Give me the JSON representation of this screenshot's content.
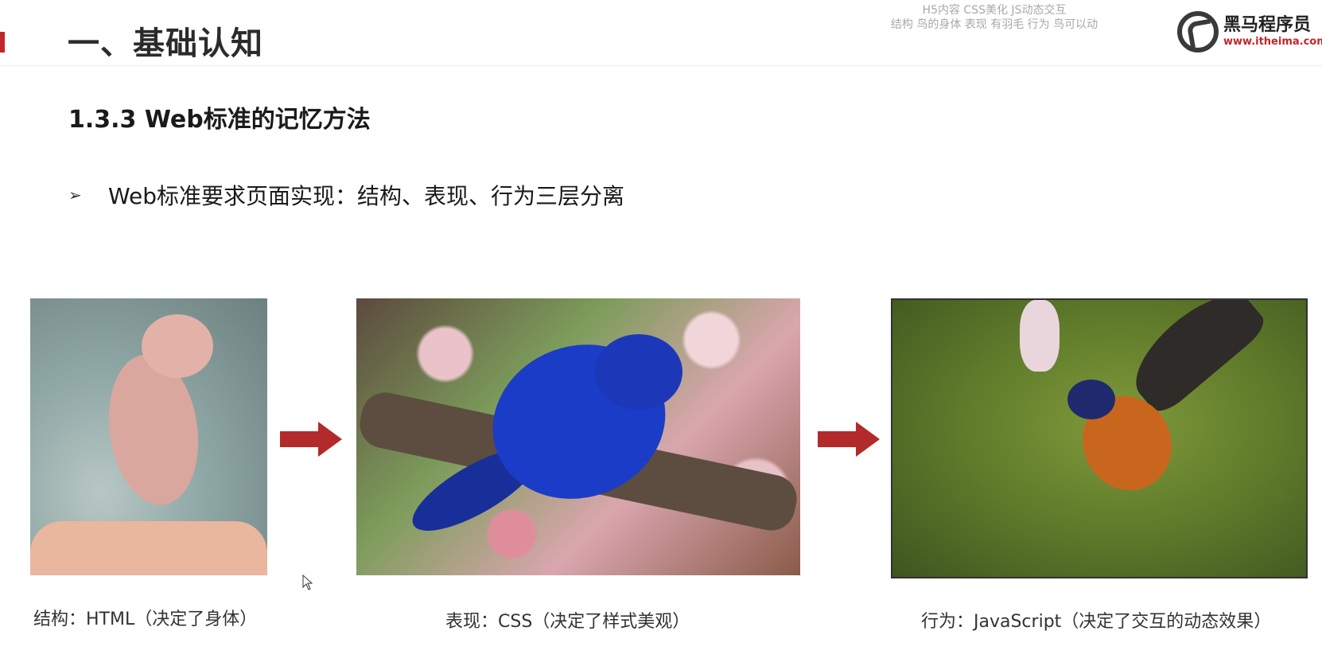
{
  "header": {
    "section_title": "一、基础认知",
    "watermark_top": "",
    "overlay_notes": [
      "H5内容 CSS美化 JS动态交互",
      "结构 鸟的身体    表现  有羽毛  行为 鸟可以动"
    ],
    "logo": {
      "name": "黑马程序员",
      "url": "www.itheima.com"
    }
  },
  "slide": {
    "subtitle": "1.3.3 Web标准的记忆方法",
    "bullet": "Web标准要求页面实现：结构、表现、行为三层分离"
  },
  "panels": [
    {
      "caption": "结构：HTML（决定了身体）"
    },
    {
      "caption": "表现：CSS（决定了样式美观）"
    },
    {
      "caption": "行为：JavaScript（决定了交互的动态效果）"
    }
  ],
  "colors": {
    "accent": "#c0262d",
    "arrow": "#b32a2a"
  }
}
